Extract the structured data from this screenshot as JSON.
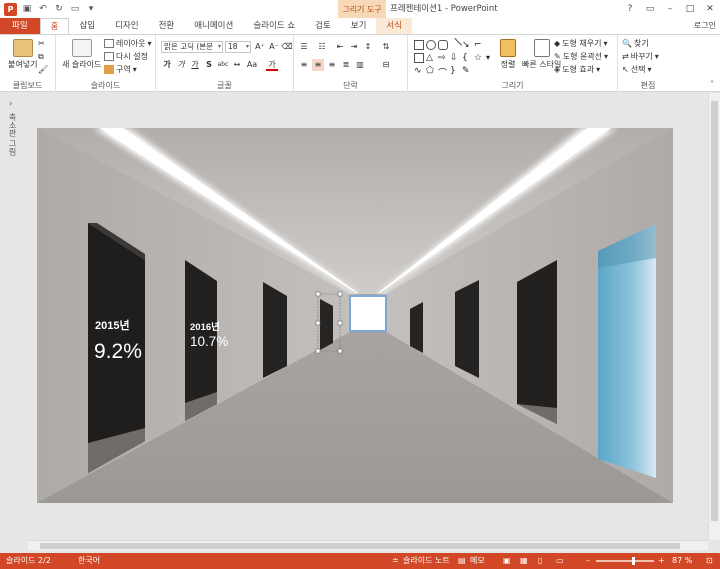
{
  "app": {
    "doc_title": "프레젠테이션1 - PowerPoint",
    "context_tools": "그리기 도구",
    "login": "로그인"
  },
  "window_controls": [
    "?",
    "▭",
    "–",
    "□",
    "✕"
  ],
  "tabs": [
    {
      "label": "파일"
    },
    {
      "label": "홈"
    },
    {
      "label": "삽입"
    },
    {
      "label": "디자인"
    },
    {
      "label": "전환"
    },
    {
      "label": "애니메이션"
    },
    {
      "label": "슬라이드 쇼"
    },
    {
      "label": "검토"
    },
    {
      "label": "보기"
    },
    {
      "label": "서식"
    }
  ],
  "ribbon": {
    "clipboard": {
      "paste": "붙여넣기",
      "label": "클립보드"
    },
    "slides": {
      "new_slide": "새 슬라이드",
      "layout": "레이아웃",
      "reset": "다시 설정",
      "section": "구역",
      "label": "슬라이드"
    },
    "font": {
      "font_name": "맑은 고딕 (본문",
      "font_size": "18",
      "label": "글꼴"
    },
    "paragraph": {
      "label": "단락"
    },
    "drawing": {
      "arrange": "정렬",
      "quick_styles": "빠른 스타일",
      "fill": "도형 채우기",
      "outline": "도형 윤곽선",
      "effects": "도형 효과",
      "label": "그리기"
    },
    "editing": {
      "find": "찾기",
      "replace": "바꾸기",
      "select": "선택",
      "label": "편집"
    }
  },
  "left_pane": {
    "toggle": "축소판 그림"
  },
  "slide": {
    "panels": [
      {
        "year": "2015년",
        "value": "9.2%"
      },
      {
        "year": "2016년",
        "value": "10.7%"
      }
    ]
  },
  "status": {
    "slide_info": "슬라이드 2/2",
    "language": "한국어",
    "notes": "슬라이드 노트",
    "comments": "메모",
    "zoom": "87 %",
    "zoom_level": 0.62
  },
  "colors": {
    "accent": "#d24726",
    "floor": "#9f9b98",
    "wall": "#a7a3a0",
    "door": "#2b2a29",
    "window": "#6ab0cf"
  }
}
